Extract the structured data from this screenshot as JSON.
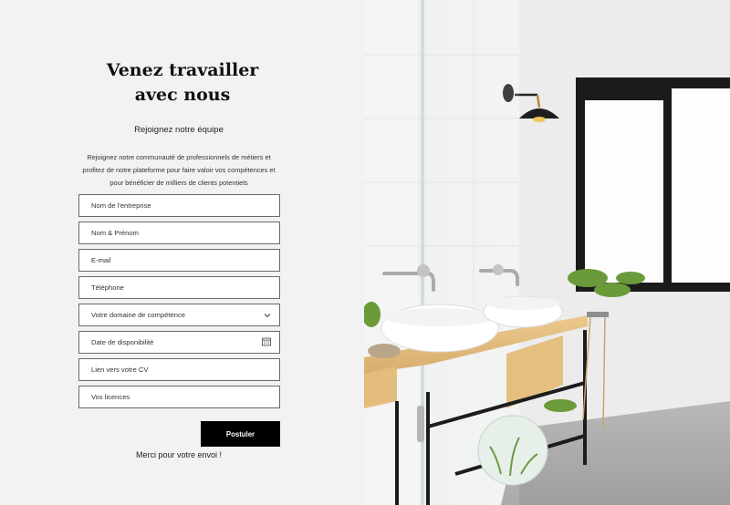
{
  "form": {
    "title": "Venez travailler avec nous",
    "subtitle": "Rejoignez notre équipe",
    "intro": "Rejoignez notre communauté de professionnels de métiers et profitez de notre plateforme pour faire valoir vos compétences et pour bénéficier de milliers de clients potentiels",
    "fields": [
      {
        "placeholder": "Nom de l'entreprise"
      },
      {
        "placeholder": "Nom & Prénom"
      },
      {
        "placeholder": "E-mail"
      },
      {
        "placeholder": "Téléphone"
      },
      {
        "placeholder": "Votre domaine de compétence",
        "icon": "chevron-down-icon"
      },
      {
        "placeholder": "Date de disponibilité",
        "icon": "calendar-icon"
      },
      {
        "placeholder": "Lien vers votre CV"
      },
      {
        "placeholder": "Vos licences"
      }
    ],
    "submit_label": "Postuler",
    "success_message": "Merci pour votre envoi !"
  },
  "image": {
    "subject": "bathroom-photo"
  },
  "colors": {
    "panel_bg": "#f2f2f2",
    "button_bg": "#000000",
    "button_text": "#ffffff",
    "field_border": "#6a6a6a"
  }
}
